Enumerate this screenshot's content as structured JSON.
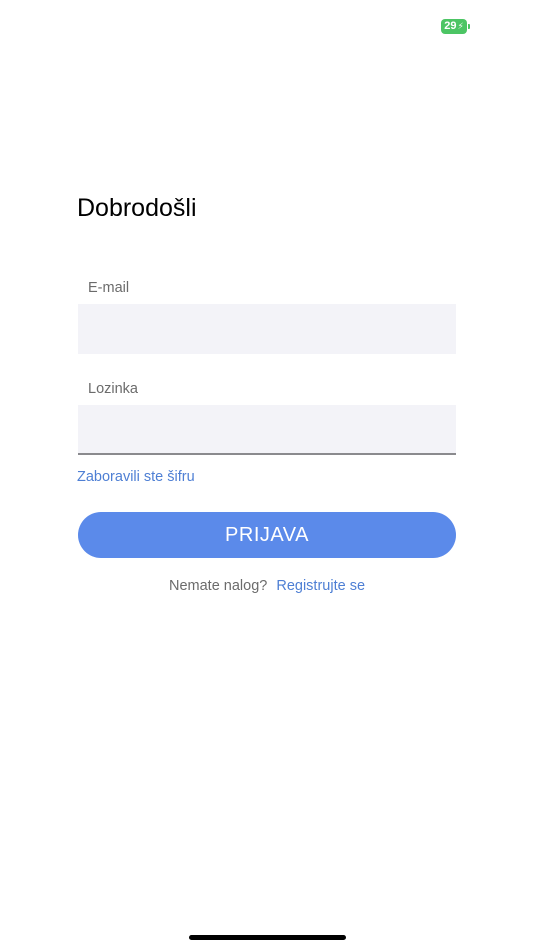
{
  "status_bar": {
    "battery_level": "29",
    "battery_charging": true,
    "battery_color": "#4cc564",
    "bolt_icon": "bolt-icon"
  },
  "login": {
    "title": "Dobrodošli",
    "email_label": "E-mail",
    "email_value": "",
    "password_label": "Lozinka",
    "password_value": "",
    "forgot_password": "Zaboravili ste šifru",
    "login_button": "PRIJAVA",
    "signup_prompt": "Nemate nalog?",
    "signup_link": "Registrujte se"
  },
  "colors": {
    "accent": "#5b8aea",
    "link": "#4e7fd4",
    "field_bg": "#f3f3f8"
  }
}
